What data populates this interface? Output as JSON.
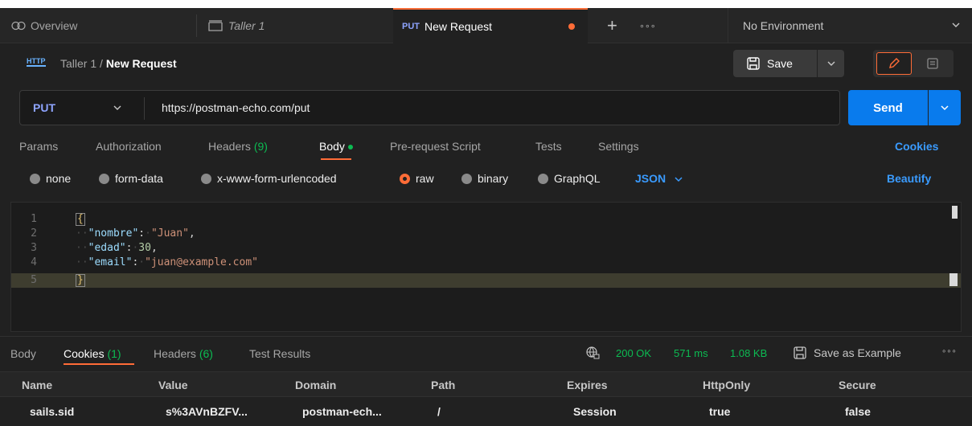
{
  "tabs": [
    {
      "label": "Overview",
      "icon": "overview-icon"
    },
    {
      "label": "Taller 1",
      "icon": "collection-icon"
    },
    {
      "method": "PUT",
      "label": "New Request",
      "active": true,
      "unsaved": true
    }
  ],
  "new_tab_glyph": "+",
  "more_glyph": "∘∘∘",
  "environment": {
    "label": "No Environment"
  },
  "breadcrumb": {
    "badge": "HTTP",
    "collection": "Taller 1",
    "separator": "/",
    "request": "New Request"
  },
  "toolbar": {
    "save_label": "Save"
  },
  "request": {
    "method": "PUT",
    "url": "https://postman-echo.com/put",
    "send_label": "Send"
  },
  "request_tabs": [
    {
      "label": "Params"
    },
    {
      "label": "Authorization"
    },
    {
      "label": "Headers",
      "count": "(9)"
    },
    {
      "label": "Body",
      "active": true
    },
    {
      "label": "Pre-request Script"
    },
    {
      "label": "Tests"
    },
    {
      "label": "Settings"
    }
  ],
  "cookies_link": "Cookies",
  "body_types": [
    {
      "label": "none"
    },
    {
      "label": "form-data"
    },
    {
      "label": "x-www-form-urlencoded"
    },
    {
      "label": "raw",
      "selected": true
    },
    {
      "label": "binary"
    },
    {
      "label": "GraphQL"
    }
  ],
  "language": "JSON",
  "beautify_label": "Beautify",
  "editor": {
    "lines": [
      {
        "num": "1"
      },
      {
        "num": "2",
        "key": "\"nombre\"",
        "value": "\"Juan\"",
        "trail": ","
      },
      {
        "num": "3",
        "key": "\"edad\"",
        "value": "30",
        "trail": ","
      },
      {
        "num": "4",
        "key": "\"email\"",
        "value": "\"juan@example.com\"",
        "trail": ""
      },
      {
        "num": "5"
      }
    ],
    "open_brace": "{",
    "close_brace": "}"
  },
  "response_tabs": [
    {
      "label": "Body"
    },
    {
      "label": "Cookies",
      "count": "(1)",
      "active": true
    },
    {
      "label": "Headers",
      "count": "(6)"
    },
    {
      "label": "Test Results"
    }
  ],
  "response_status": {
    "code": "200 OK",
    "time": "571 ms",
    "size": "1.08 KB"
  },
  "save_example_label": "Save as Example",
  "cookies_table": {
    "columns": [
      "Name",
      "Value",
      "Domain",
      "Path",
      "Expires",
      "HttpOnly",
      "Secure"
    ],
    "rows": [
      [
        "sails.sid",
        "s%3AVnBZFV...",
        "postman-ech...",
        "/",
        "Session",
        "true",
        "false"
      ]
    ]
  },
  "colors": {
    "accent": "#ff6c37",
    "send": "#097bed",
    "success": "#0cbb52",
    "link": "#3a9bff"
  }
}
